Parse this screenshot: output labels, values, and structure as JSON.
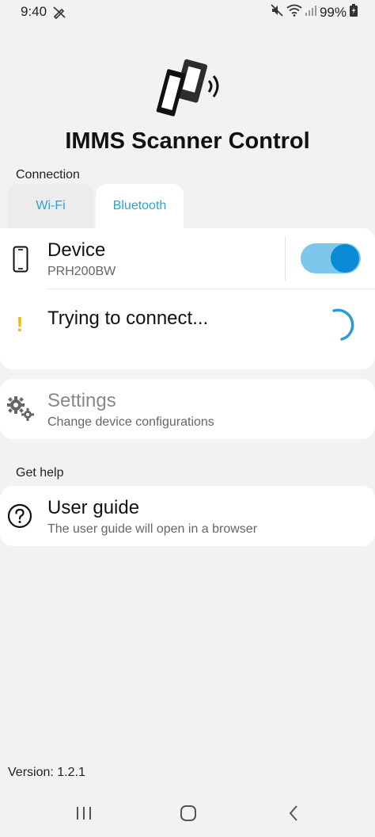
{
  "status_bar": {
    "time": "9:40",
    "battery": "99%",
    "icons": [
      "edit-off-icon",
      "mute-icon",
      "wifi-icon",
      "signal-icon",
      "battery-icon"
    ]
  },
  "app": {
    "title": "IMMS Scanner Control",
    "logo": "scanner-logo-icon"
  },
  "connection": {
    "section_label": "Connection",
    "tabs": [
      {
        "label": "Wi-Fi",
        "selected": false
      },
      {
        "label": "Bluetooth",
        "selected": true
      }
    ],
    "device": {
      "title": "Device",
      "subtitle": "PRH200BW",
      "icon": "phone-icon",
      "toggle_on": true
    },
    "status": {
      "text": "Trying to connect...",
      "icon": "warning-icon"
    }
  },
  "settings": {
    "title": "Settings",
    "subtitle": "Change device configurations",
    "icon": "gears-icon"
  },
  "help": {
    "section_label": "Get help",
    "guide_title": "User guide",
    "guide_subtitle": "The user guide will open in a browser",
    "icon": "help-icon"
  },
  "footer": {
    "version": "Version: 1.2.1"
  },
  "nav": {
    "buttons": [
      "recent-apps-icon",
      "home-icon",
      "back-icon"
    ]
  },
  "colors": {
    "accent": "#29a3d6",
    "toggle_track": "#7ec6ec",
    "toggle_knob": "#0a8ad4",
    "warning": "#f5b800",
    "background": "#f2f2f2"
  }
}
